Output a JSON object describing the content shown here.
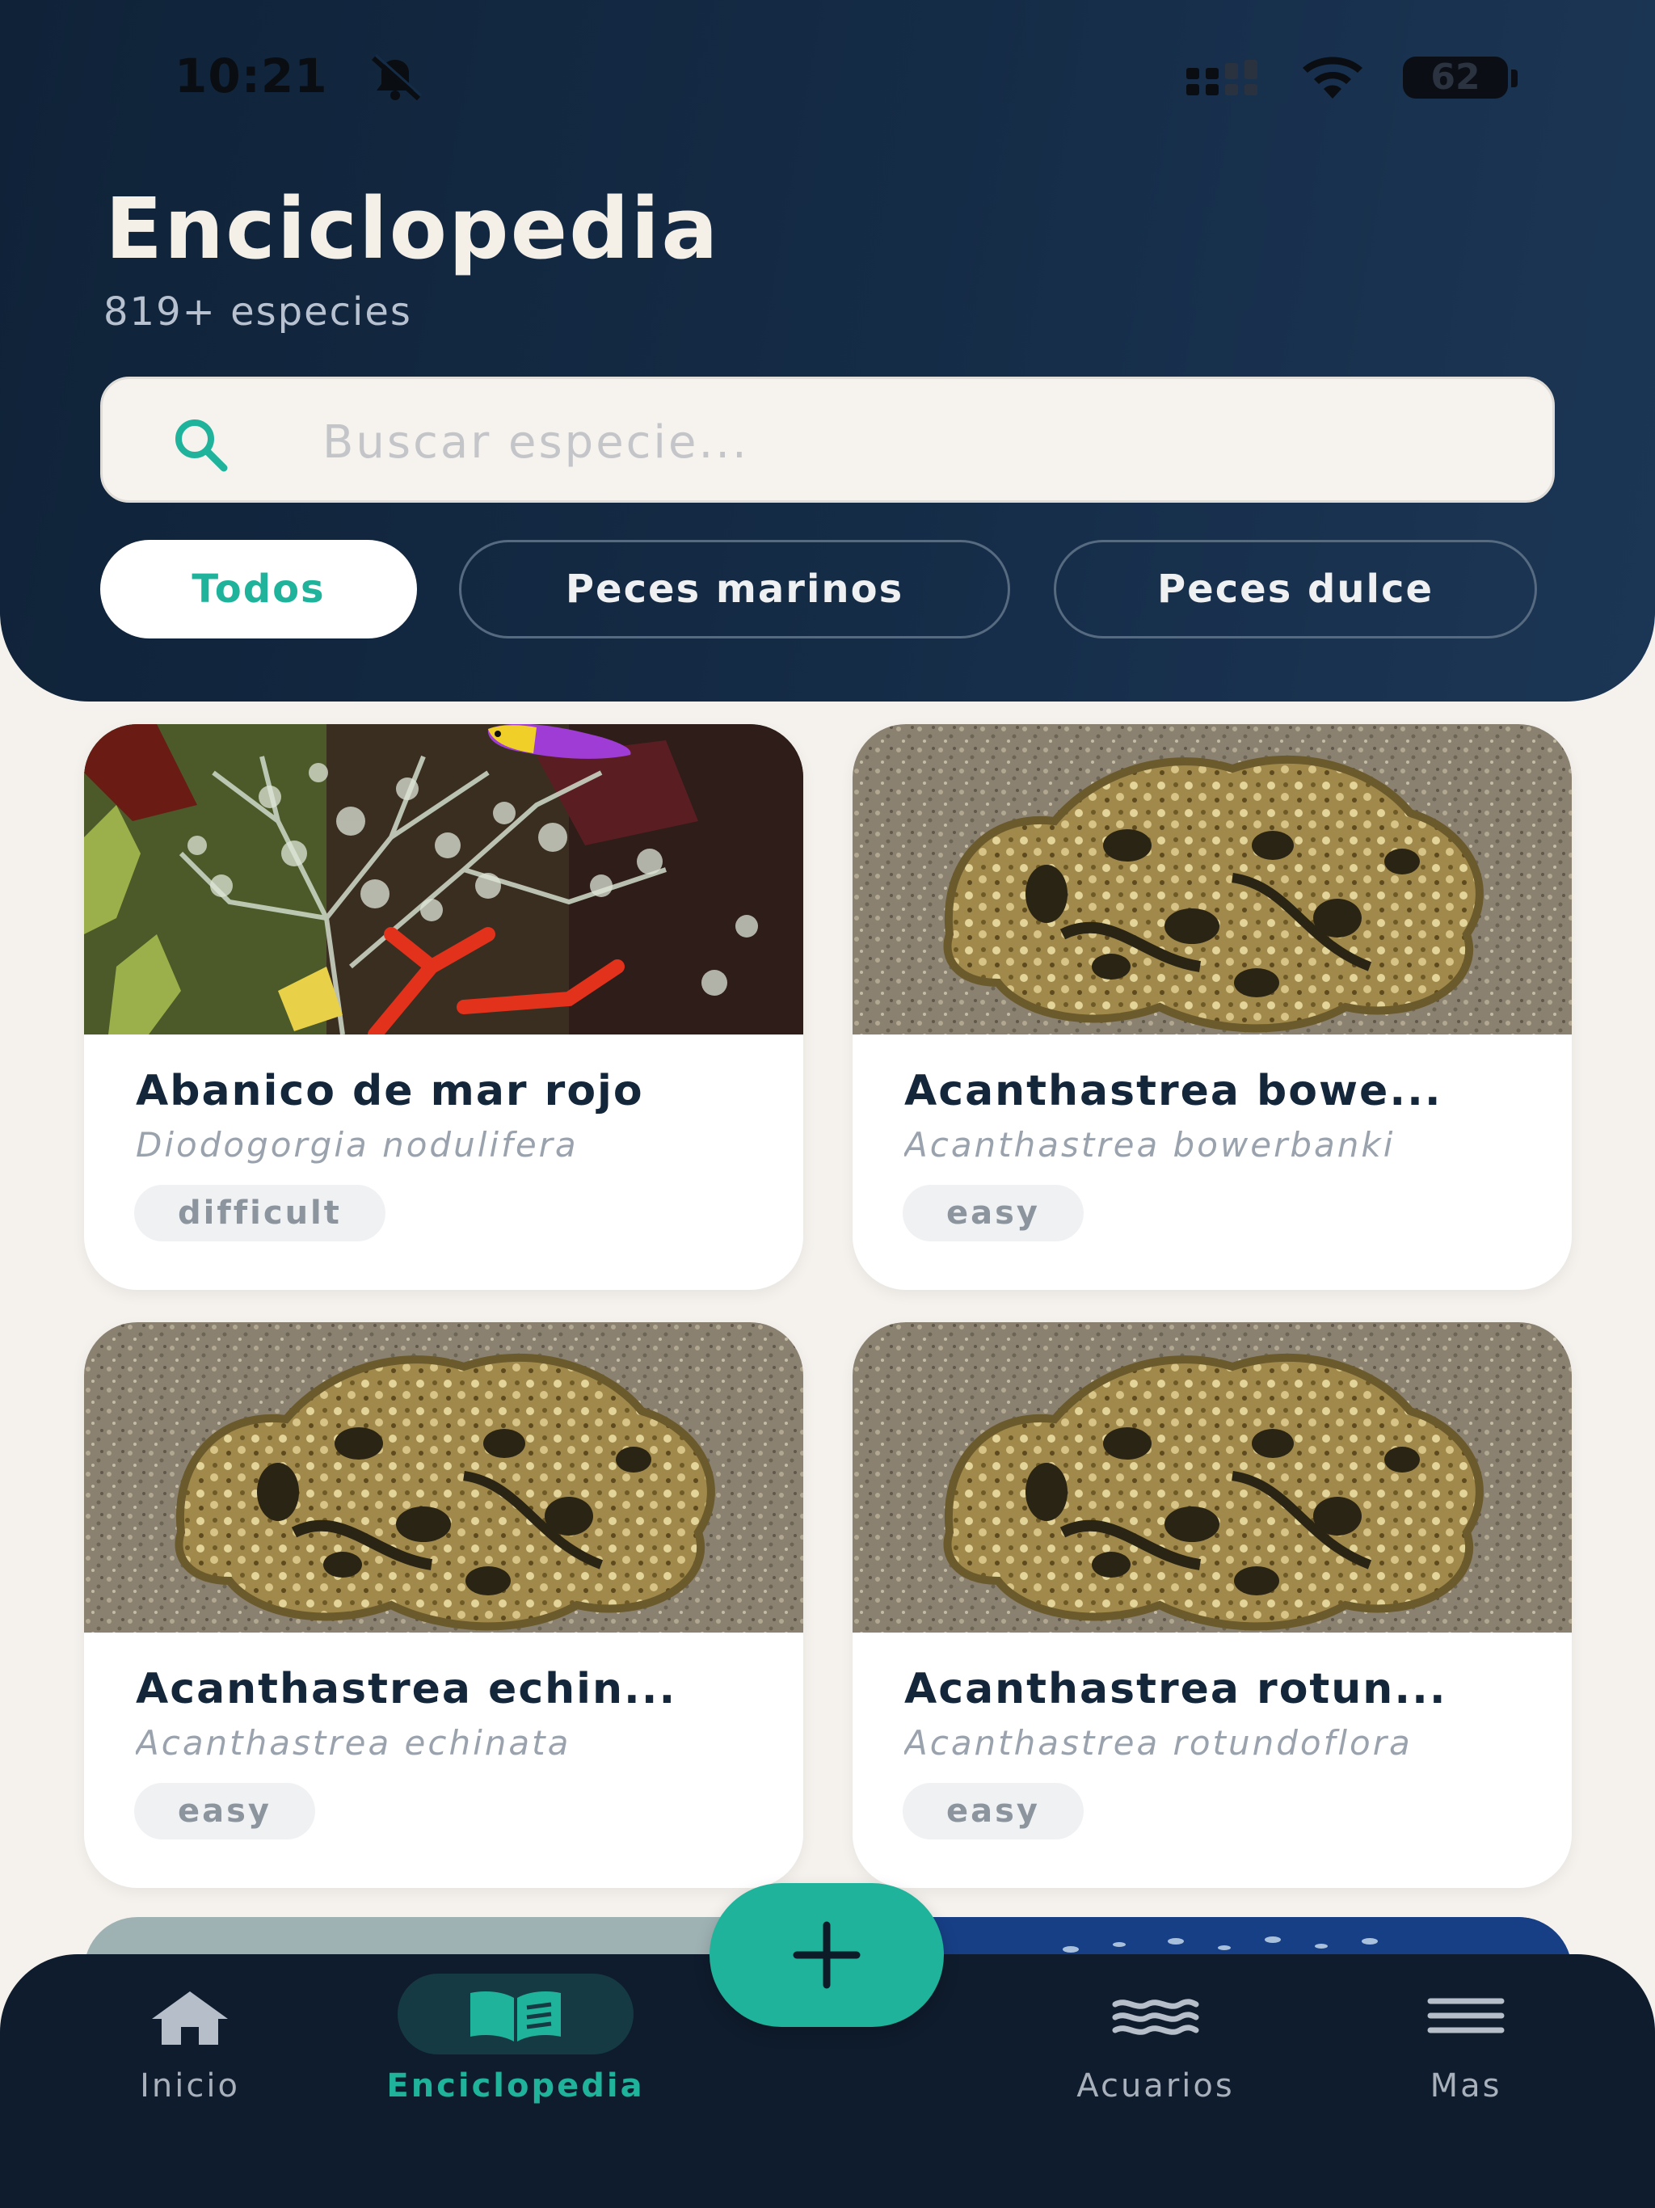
{
  "status_bar": {
    "time": "10:21",
    "battery": "62"
  },
  "header": {
    "title": "Enciclopedia",
    "subtitle": "819+ especies",
    "search_placeholder": "Buscar especie..."
  },
  "filters": [
    {
      "label": "Todos",
      "active": true
    },
    {
      "label": "Peces marinos",
      "active": false
    },
    {
      "label": "Peces dulce",
      "active": false
    }
  ],
  "species": [
    {
      "name": "Abanico de mar rojo",
      "scientific": "Diodogorgia nodulifera",
      "difficulty": "difficult",
      "image": "red-sea-fan-photo"
    },
    {
      "name": "Acanthastrea bowe...",
      "scientific": "Acanthastrea bowerbanki",
      "difficulty": "easy",
      "image": "coral-photo"
    },
    {
      "name": "Acanthastrea echin...",
      "scientific": "Acanthastrea echinata",
      "difficulty": "easy",
      "image": "coral-photo"
    },
    {
      "name": "Acanthastrea rotun...",
      "scientific": "Acanthastrea rotundoflora",
      "difficulty": "easy",
      "image": "coral-photo"
    }
  ],
  "bottom_nav": [
    {
      "label": "Inicio",
      "icon": "home-icon",
      "active": false
    },
    {
      "label": "Enciclopedia",
      "icon": "book-icon",
      "active": true
    },
    {
      "label": "Acuarios",
      "icon": "waves-icon",
      "active": false
    },
    {
      "label": "Mas",
      "icon": "menu-icon",
      "active": false
    }
  ],
  "fab": {
    "icon": "plus-icon"
  },
  "colors": {
    "header_bg": "#152c47",
    "accent": "#1fb39b",
    "page_bg": "#f5f2ee",
    "nav_bg": "#0f1c2d"
  }
}
